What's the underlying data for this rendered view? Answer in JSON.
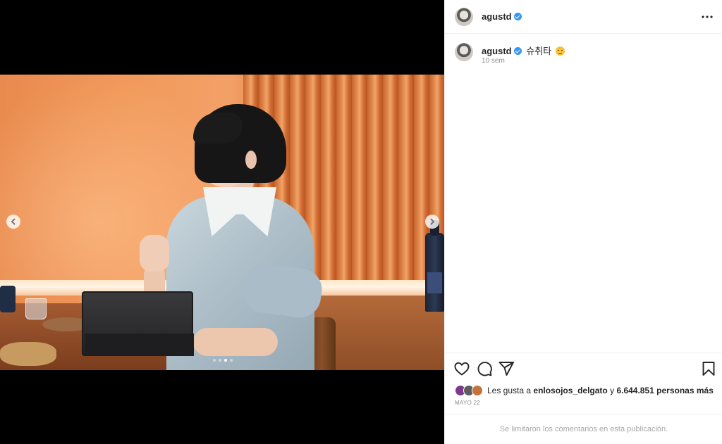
{
  "post": {
    "username": "agustd",
    "verified": true,
    "caption": "슈취타",
    "caption_emoji": "relieved-face",
    "time_ago": "10 sem",
    "likes_prefix": "Les gusta a",
    "liked_by": "enlosojos_delgato",
    "likes_connector": "y",
    "likes_count": "6.644.851 personas más",
    "date": "MAYO 22",
    "comments_notice": "Se limitaron los comentarios en esta publicación."
  },
  "carousel": {
    "total_slides": 4,
    "current_slide": 3
  },
  "icons": {
    "more": "more-horizontal-icon",
    "like": "heart-icon",
    "comment": "comment-icon",
    "share": "share-icon",
    "save": "bookmark-icon",
    "prev": "chevron-left-icon",
    "next": "chevron-right-icon"
  },
  "colors": {
    "verified_badge": "#3897f0",
    "muted_text": "#8e8e8e"
  }
}
